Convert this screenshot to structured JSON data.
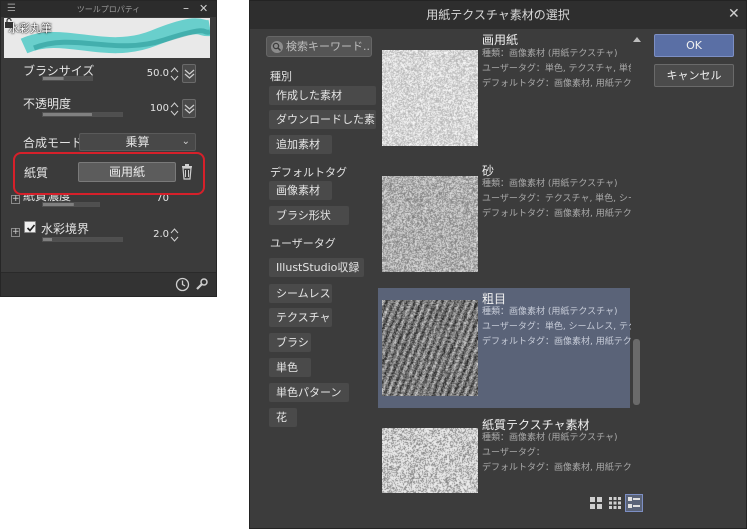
{
  "tool_property": {
    "title": "ツールプロパティ",
    "brush_name": "水彩丸筆",
    "properties": {
      "brush_size": {
        "label": "ブラシサイズ",
        "value": "50.0",
        "level": 0.42
      },
      "opacity": {
        "label": "不透明度",
        "value": "100",
        "level": 0.62
      },
      "blend_mode": {
        "label": "合成モード",
        "value": "乗算"
      },
      "paper": {
        "label": "紙質",
        "value": "画用紙"
      },
      "paper_density": {
        "label": "紙質濃度",
        "value": "70",
        "level": 0.55
      },
      "watercolor_edge": {
        "label": "水彩境界",
        "value": "2.0",
        "level": 0.12
      }
    },
    "colors": {
      "highlight": "#d6202a",
      "stroke": "#3ec6c2"
    }
  },
  "dialog": {
    "title": "用紙テクスチャ素材の選択",
    "search_placeholder": "検索キーワード...",
    "sections": {
      "kind": {
        "label": "種別",
        "items": [
          "作成した素材",
          "ダウンロードした素",
          "追加素材"
        ]
      },
      "default_tag": {
        "label": "デフォルトタグ",
        "items": [
          "画像素材",
          "ブラシ形状"
        ]
      },
      "user_tag": {
        "label": "ユーザータグ",
        "items": [
          "IllustStudio収録",
          "シームレス",
          "テクスチャ",
          "ブラシ",
          "単色",
          "単色パターン",
          "花"
        ]
      }
    },
    "materials": [
      {
        "name": "画用紙",
        "kind": "種類：画像素材 (用紙テクスチャ)",
        "user_tag": "ユーザータグ：単色, テクスチャ, 単色パタ",
        "default_tag": "デフォルトタグ：画像素材, 用紙テクスチャ"
      },
      {
        "name": "砂",
        "kind": "種類：画像素材 (用紙テクスチャ)",
        "user_tag": "ユーザータグ：テクスチャ, 単色, シームレ",
        "default_tag": "デフォルトタグ：画像素材, 用紙テクスチャ"
      },
      {
        "name": "粗目",
        "kind": "種類：画像素材 (用紙テクスチャ)",
        "user_tag": "ユーザータグ：単色, シームレス, テクスチ",
        "default_tag": "デフォルトタグ：画像素材, 用紙テクスチャ"
      },
      {
        "name": "紙質テクスチャ素材",
        "kind": "種類：画像素材 (用紙テクスチャ)",
        "user_tag": "ユーザータグ：",
        "default_tag": "デフォルトタグ：画像素材, 用紙テクスチャ"
      }
    ],
    "selected_index": 2,
    "ok_label": "OK",
    "cancel_label": "キャンセル",
    "scroll_position": 0.66,
    "colors": {
      "selection": "#5a6378",
      "ok": "#5a6fa5"
    }
  }
}
